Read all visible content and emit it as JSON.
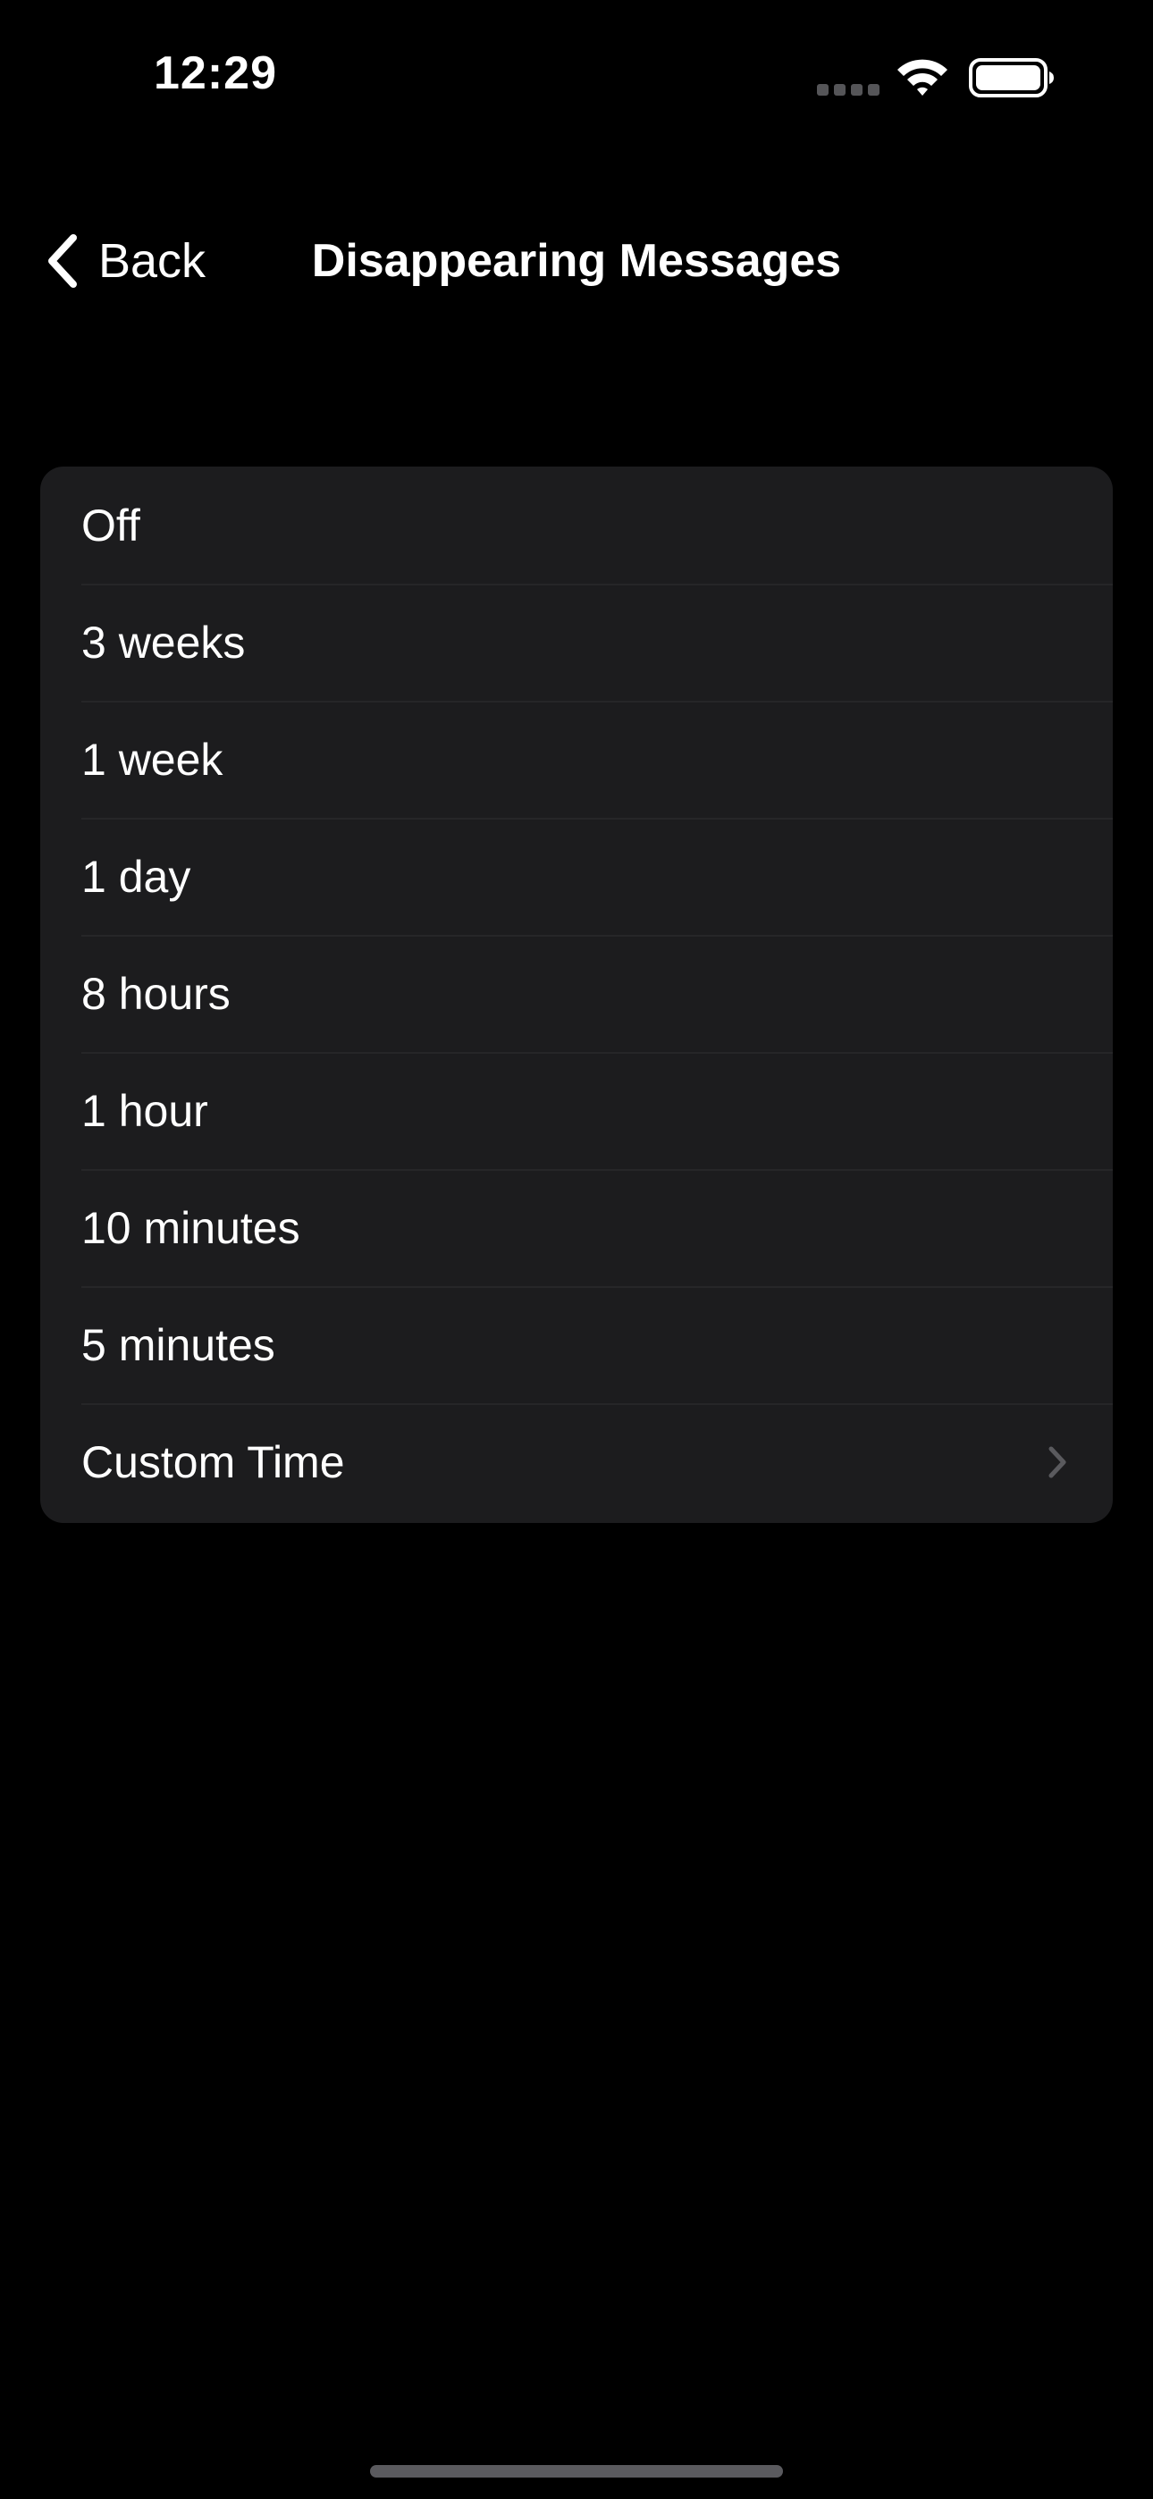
{
  "status_bar": {
    "time": "12:29",
    "icons": [
      "signal-dots-icon",
      "wifi-icon",
      "battery-icon"
    ]
  },
  "nav": {
    "back_label": "Back",
    "title": "Disappearing Messages",
    "back_icon": "chevron-left-icon"
  },
  "options": [
    {
      "label": "Off"
    },
    {
      "label": "3 weeks"
    },
    {
      "label": "1 week"
    },
    {
      "label": "1 day"
    },
    {
      "label": "8 hours"
    },
    {
      "label": "1 hour"
    },
    {
      "label": "10 minutes"
    },
    {
      "label": "5 minutes"
    },
    {
      "label": "Custom Time",
      "icon": "chevron-right-icon"
    }
  ],
  "colors": {
    "background": "#000000",
    "card": "#1c1c1e",
    "text": "#ffffff",
    "separator": "#262628",
    "secondary_icon": "#5a5a5e"
  }
}
